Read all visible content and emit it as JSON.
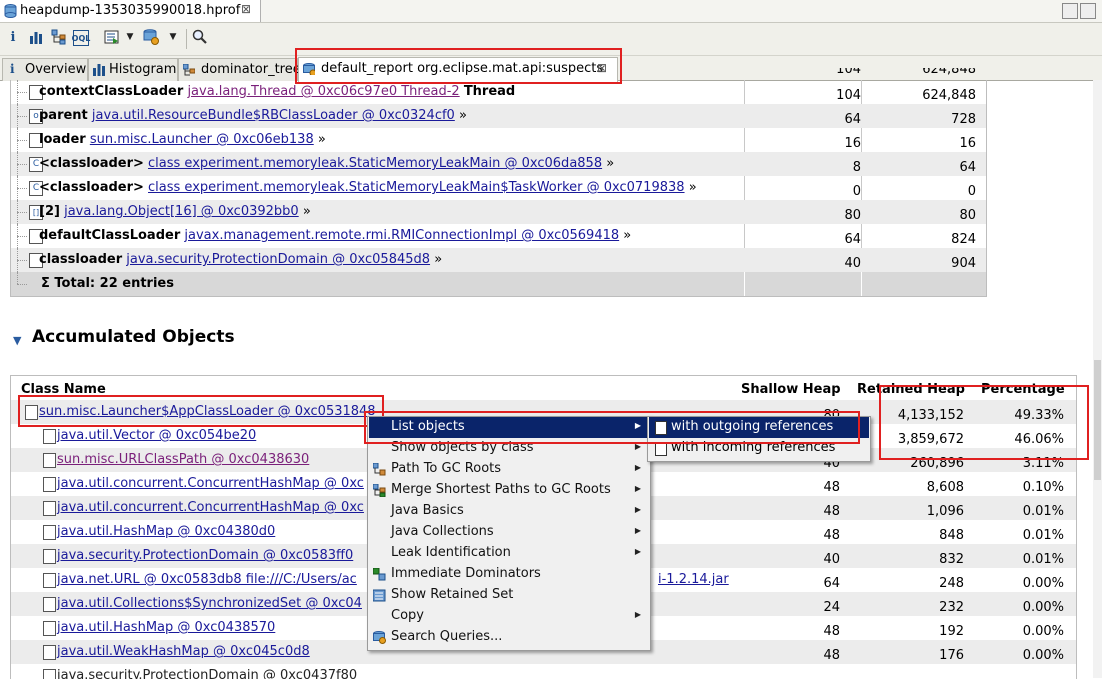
{
  "editor_tab": {
    "title": "heapdump-1353035990018.hprof",
    "close": "⊠"
  },
  "toolbar": {
    "icons": [
      "info-icon",
      "histogram-icon",
      "dominator-tree-icon",
      "oql-icon",
      "run-report-icon",
      "query-browser-icon",
      "search-icon"
    ]
  },
  "report_tabs": [
    {
      "label": "Overview"
    },
    {
      "label": "Histogram"
    },
    {
      "label": "dominator_tree"
    },
    {
      "label": "default_report  org.eclipse.mat.api:suspects",
      "close": "⊠"
    }
  ],
  "upper_table": {
    "partial_top": {
      "shallow": "104",
      "retained": "624,848"
    },
    "rows": [
      {
        "field": "contextClassLoader",
        "link": "java.lang.Thread @ 0xc06c97e0  Thread-2",
        "suffix": "Thread",
        "shallow": "104",
        "retained": "624,848",
        "icon": "T"
      },
      {
        "field": "parent",
        "link": "java.util.ResourceBundle$RBClassLoader @ 0xc0324cf0",
        "suffix": "»",
        "shallow": "64",
        "retained": "728",
        "icon": "o"
      },
      {
        "field": "loader",
        "link": "sun.misc.Launcher @ 0xc06eb138",
        "suffix": "»",
        "shallow": "16",
        "retained": "16",
        "icon": ""
      },
      {
        "field": "<classloader>",
        "link": "class experiment.memoryleak.StaticMemoryLeakMain @ 0xc06da858",
        "suffix": "»",
        "shallow": "8",
        "retained": "64",
        "icon": "C"
      },
      {
        "field": "<classloader>",
        "link": "class experiment.memoryleak.StaticMemoryLeakMain$TaskWorker @ 0xc0719838",
        "suffix": "»",
        "shallow": "0",
        "retained": "0",
        "icon": "C"
      },
      {
        "field": "[2]",
        "link": "java.lang.Object[16] @ 0xc0392bb0",
        "suffix": "»",
        "shallow": "80",
        "retained": "80",
        "icon": "[]"
      },
      {
        "field": "defaultClassLoader",
        "link": "javax.management.remote.rmi.RMIConnectionImpl @ 0xc0569418",
        "suffix": "»",
        "shallow": "64",
        "retained": "824",
        "icon": ""
      },
      {
        "field": "classloader",
        "link": "java.security.ProtectionDomain @ 0xc05845d8",
        "suffix": "»",
        "shallow": "40",
        "retained": "904",
        "icon": ""
      }
    ],
    "total": "Σ Total: 22 entries"
  },
  "section": {
    "title": "Accumulated Objects"
  },
  "lower_table": {
    "headers": {
      "class_name": "Class Name",
      "shallow": "Shallow Heap",
      "retained": "Retained Heap",
      "percentage": "Percentage"
    },
    "rows": [
      {
        "name": "sun.misc.Launcher$AppClassLoader @ 0xc0531848",
        "shallow": "80",
        "retained": "4,133,152",
        "pct": "49.33%"
      },
      {
        "name": "java.util.Vector @ 0xc054be20",
        "shallow": "",
        "retained": "3,859,672",
        "pct": "46.06%"
      },
      {
        "name": "sun.misc.URLClassPath @ 0xc0438630",
        "shallow": "40",
        "retained": "260,896",
        "pct": "3.11%"
      },
      {
        "name": "java.util.concurrent.ConcurrentHashMap @ 0xc",
        "shallow": "48",
        "retained": "8,608",
        "pct": "0.10%"
      },
      {
        "name": "java.util.concurrent.ConcurrentHashMap @ 0xc",
        "shallow": "48",
        "retained": "1,096",
        "pct": "0.01%"
      },
      {
        "name": "java.util.HashMap @ 0xc04380d0",
        "shallow": "48",
        "retained": "848",
        "pct": "0.01%"
      },
      {
        "name": "java.security.ProtectionDomain @ 0xc0583ff0",
        "shallow": "40",
        "retained": "832",
        "pct": "0.01%"
      },
      {
        "name": "java.net.URL @ 0xc0583db8  file:///C:/Users/ac",
        "tail": "i-1.2.14.jar",
        "shallow": "64",
        "retained": "248",
        "pct": "0.00%"
      },
      {
        "name": "java.util.Collections$SynchronizedSet @ 0xc04",
        "shallow": "24",
        "retained": "232",
        "pct": "0.00%"
      },
      {
        "name": "java.util.HashMap @ 0xc0438570",
        "shallow": "48",
        "retained": "192",
        "pct": "0.00%"
      },
      {
        "name": "java.util.WeakHashMap @ 0xc045c0d8",
        "shallow": "48",
        "retained": "176",
        "pct": "0.00%"
      },
      {
        "name": "java.security.ProtectionDomain @ 0xc0437f80",
        "shallow": "",
        "retained": "",
        "pct": ""
      }
    ]
  },
  "context_menu": {
    "items": [
      {
        "label": "List objects",
        "submenu": true,
        "icon": ""
      },
      {
        "label": "Show objects by class",
        "submenu": true,
        "icon": ""
      },
      {
        "label": "Path To GC Roots",
        "submenu": true,
        "icon": "gc-roots-icon"
      },
      {
        "label": "Merge Shortest Paths to GC Roots",
        "submenu": true,
        "icon": "merge-paths-icon"
      },
      {
        "label": "Java Basics",
        "submenu": true,
        "icon": ""
      },
      {
        "label": "Java Collections",
        "submenu": true,
        "icon": ""
      },
      {
        "label": "Leak Identification",
        "submenu": true,
        "icon": ""
      },
      {
        "label": "Immediate Dominators",
        "submenu": false,
        "icon": "dominators-icon"
      },
      {
        "label": "Show Retained Set",
        "submenu": false,
        "icon": "retained-set-icon"
      },
      {
        "label": "Copy",
        "submenu": true,
        "icon": ""
      },
      {
        "label": "Search Queries...",
        "submenu": false,
        "icon": "search-queries-icon"
      }
    ],
    "submenu": [
      {
        "label": "with outgoing references"
      },
      {
        "label": "with incoming references"
      }
    ]
  },
  "colors": {
    "highlight": "#e02020",
    "selection": "#0a246a",
    "link": "#1a1a9a",
    "visited": "#7a1f7a"
  }
}
